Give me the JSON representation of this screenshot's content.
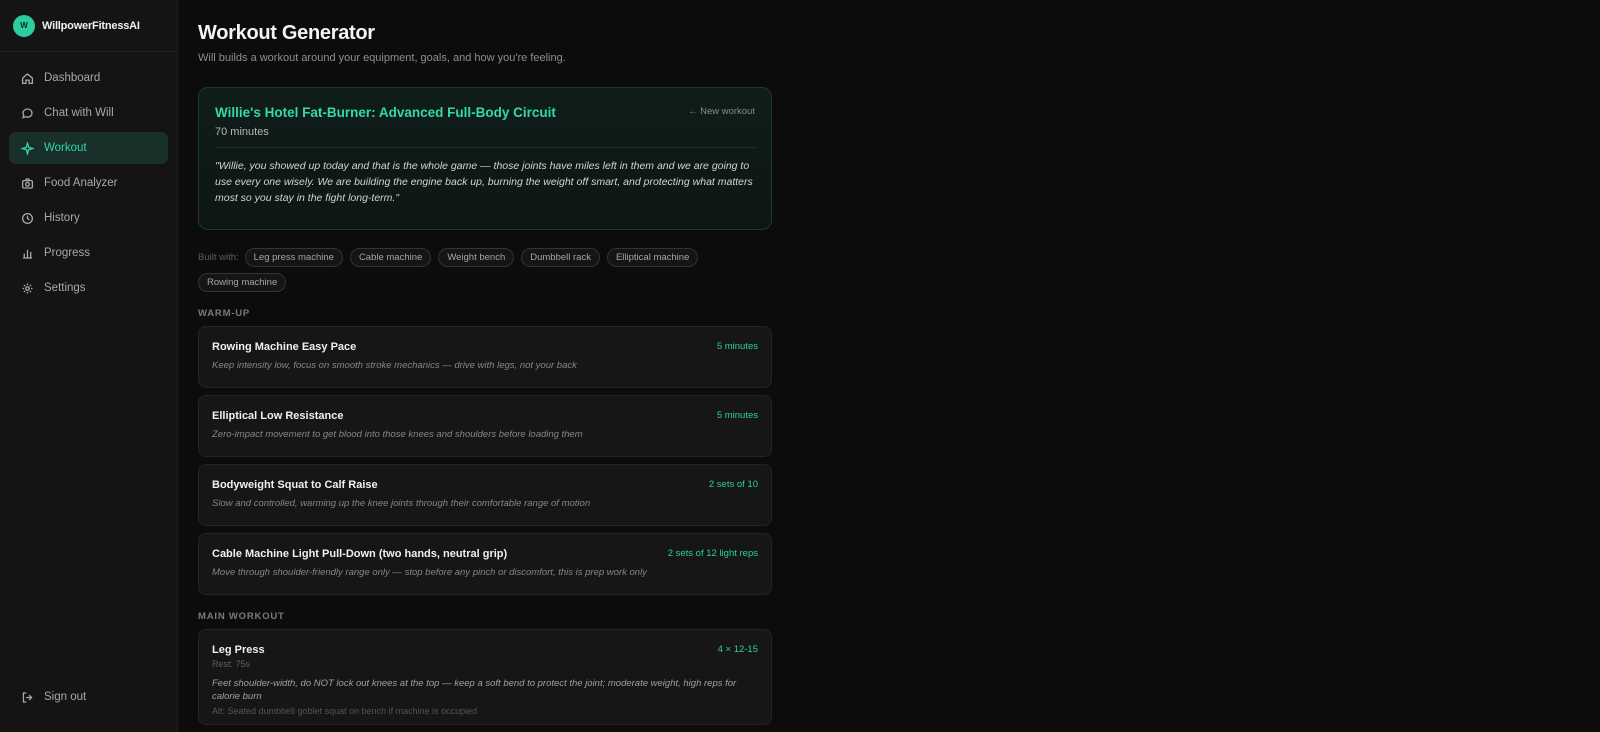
{
  "brand": {
    "logo_letter": "W",
    "name": "WillpowerFitnessAI"
  },
  "nav": {
    "items": [
      {
        "label": "Dashboard",
        "icon": "home-icon",
        "active": false
      },
      {
        "label": "Chat with Will",
        "icon": "chat-icon",
        "active": false
      },
      {
        "label": "Workout",
        "icon": "sparkle-icon",
        "active": true
      },
      {
        "label": "Food Analyzer",
        "icon": "camera-icon",
        "active": false
      },
      {
        "label": "History",
        "icon": "clock-icon",
        "active": false
      },
      {
        "label": "Progress",
        "icon": "bar-chart-icon",
        "active": false
      },
      {
        "label": "Settings",
        "icon": "gear-icon",
        "active": false
      }
    ],
    "sign_out": "Sign out"
  },
  "page": {
    "title": "Workout Generator",
    "subtitle": "Will builds a workout around your equipment, goals, and how you're feeling."
  },
  "hero": {
    "title": "Willie's Hotel Fat-Burner: Advanced Full-Body Circuit",
    "duration": "70 minutes",
    "new_workout": "← New workout",
    "quote": "\"Willie, you showed up today and that is the whole game — those joints have miles left in them and we are going to use every one wisely. We are building the engine back up, burning the weight off smart, and protecting what matters most so you stay in the fight long-term.\""
  },
  "equipment": {
    "label": "Built with:",
    "items": [
      "Leg press machine",
      "Cable machine",
      "Weight bench",
      "Dumbbell rack",
      "Elliptical machine",
      "Rowing machine"
    ]
  },
  "warmup": {
    "label": "WARM-UP",
    "exercises": [
      {
        "name": "Rowing Machine Easy Pace",
        "meta": "5 minutes",
        "desc": "Keep intensity low, focus on smooth stroke mechanics — drive with legs, not your back"
      },
      {
        "name": "Elliptical Low Resistance",
        "meta": "5 minutes",
        "desc": "Zero-impact movement to get blood into those knees and shoulders before loading them"
      },
      {
        "name": "Bodyweight Squat to Calf Raise",
        "meta": "2 sets of 10",
        "desc": "Slow and controlled, warming up the knee joints through their comfortable range of motion"
      },
      {
        "name": "Cable Machine Light Pull-Down (two hands, neutral grip)",
        "meta": "2 sets of 12 light reps",
        "desc": "Move through shoulder-friendly range only — stop before any pinch or discomfort, this is prep work only"
      }
    ]
  },
  "main_workout": {
    "label": "MAIN WORKOUT",
    "exercises": [
      {
        "name": "Leg Press",
        "meta": "4 × 12-15",
        "rest": "Rest: 75s",
        "desc": "Feet shoulder-width, do NOT lock out knees at the top — keep a soft bend to protect the joint; moderate weight, high reps for calorie burn",
        "alt": "Alt: Seated dumbbell goblet squat on bench if machine is occupied"
      }
    ]
  }
}
